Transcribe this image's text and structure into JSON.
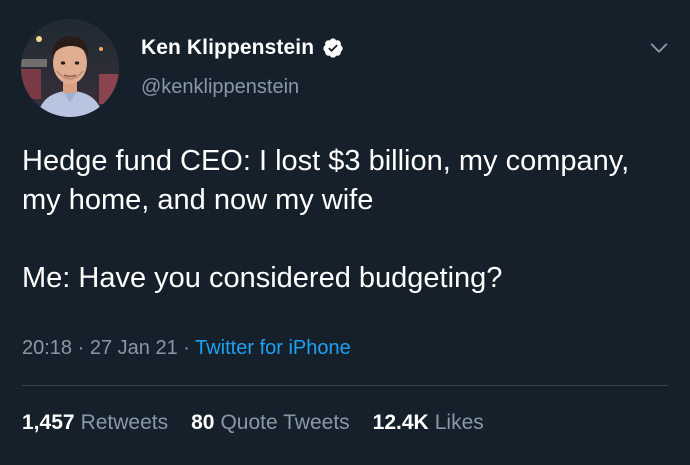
{
  "colors": {
    "background": "#15202b",
    "primary_text": "#ffffff",
    "secondary_text": "#8899a6",
    "link": "#1da1f2",
    "divider": "#38444d"
  },
  "author": {
    "display_name": "Ken Klippenstein",
    "handle": "@kenklippenstein",
    "verified": true,
    "verified_icon": "verified-badge-icon",
    "avatar_icon": "avatar-photo"
  },
  "menu": {
    "icon": "chevron-down-icon"
  },
  "tweet": {
    "text_line_1": "Hedge fund CEO: I lost $3 billion, my company, my home, and now my wife",
    "text_line_2": "Me: Have you considered budgeting?",
    "time": "20:18",
    "separator_1": " · ",
    "date": "27 Jan 21",
    "separator_2": " · ",
    "source": "Twitter for iPhone"
  },
  "stats": {
    "retweets_count": "1,457",
    "retweets_label": "Retweets",
    "quotes_count": "80",
    "quotes_label": "Quote Tweets",
    "likes_count": "12.4K",
    "likes_label": "Likes"
  }
}
